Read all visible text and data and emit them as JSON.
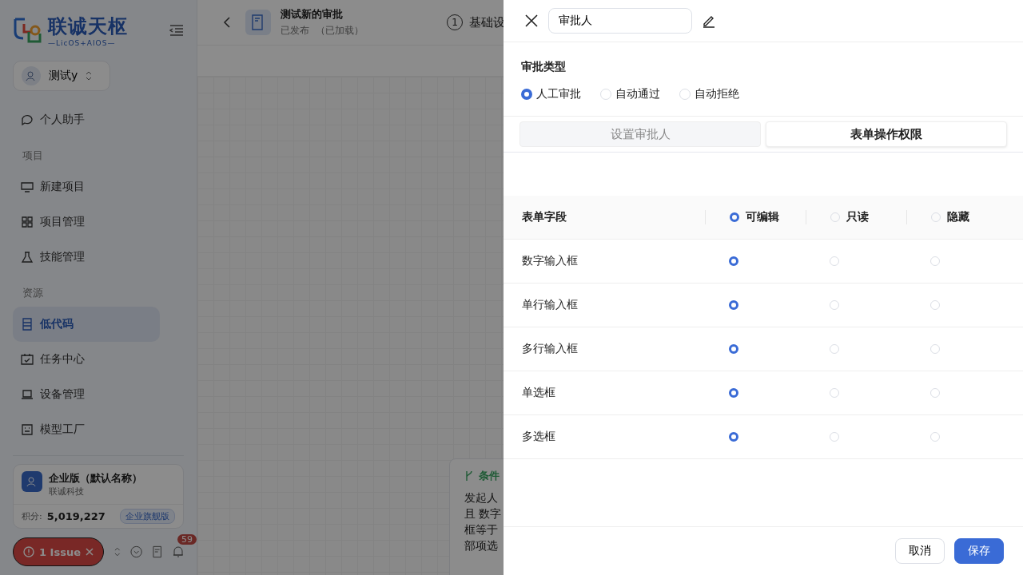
{
  "sidebar": {
    "logo": {
      "name": "联诚天枢",
      "sub": "—LicOS+AIOS—"
    },
    "workspace": "测试y",
    "nav": [
      {
        "kind": "item",
        "label": "个人助手",
        "selected": false
      },
      {
        "kind": "section",
        "label": "项目"
      },
      {
        "kind": "item",
        "label": "新建项目",
        "selected": false
      },
      {
        "kind": "item",
        "label": "项目管理",
        "selected": false
      },
      {
        "kind": "item",
        "label": "技能管理",
        "selected": false
      },
      {
        "kind": "section",
        "label": "资源"
      },
      {
        "kind": "item",
        "label": "低代码",
        "selected": true
      },
      {
        "kind": "item",
        "label": "任务中心",
        "selected": false
      },
      {
        "kind": "item",
        "label": "设备管理",
        "selected": false
      },
      {
        "kind": "item",
        "label": "模型工厂",
        "selected": false
      }
    ],
    "enterprise": {
      "name": "企业版（默认名称）",
      "company": "联诚科技",
      "points_label": "积分:",
      "points": "5,019,227",
      "badge": "企业旗舰版"
    },
    "issue": "1 Issue",
    "notifications": "59"
  },
  "header": {
    "title": "测试新的审批",
    "status": "已发布",
    "loaded": "（已加载）",
    "step": {
      "number": "1",
      "label": "基础设"
    }
  },
  "condition_card": {
    "title": "条件",
    "lines": [
      "发起人",
      "且 数字",
      "框等于",
      "部项选"
    ]
  },
  "drawer": {
    "name": "审批人",
    "approval_type": {
      "label": "审批类型",
      "options": [
        {
          "label": "人工审批",
          "selected": true
        },
        {
          "label": "自动通过",
          "selected": false
        },
        {
          "label": "自动拒绝",
          "selected": false
        }
      ]
    },
    "tabs": [
      {
        "label": "设置审批人",
        "selected": false
      },
      {
        "label": "表单操作权限",
        "selected": true
      }
    ],
    "table": {
      "field_header": "表单字段",
      "permissions": [
        {
          "label": "可编辑",
          "selected": true
        },
        {
          "label": "只读",
          "selected": false
        },
        {
          "label": "隐藏",
          "selected": false
        }
      ],
      "rows": [
        {
          "field": "数字输入框",
          "options": [
            {
              "selected": true
            },
            {
              "selected": false
            },
            {
              "selected": false
            }
          ]
        },
        {
          "field": "单行输入框",
          "options": [
            {
              "selected": true
            },
            {
              "selected": false
            },
            {
              "selected": false
            }
          ]
        },
        {
          "field": "多行输入框",
          "options": [
            {
              "selected": true
            },
            {
              "selected": false
            },
            {
              "selected": false
            }
          ]
        },
        {
          "field": "单选框",
          "options": [
            {
              "selected": true
            },
            {
              "selected": false
            },
            {
              "selected": false
            }
          ]
        },
        {
          "field": "多选框",
          "options": [
            {
              "selected": true
            },
            {
              "selected": false
            },
            {
              "selected": false
            }
          ]
        }
      ]
    },
    "buttons": {
      "cancel": "取消",
      "save": "保存"
    }
  }
}
